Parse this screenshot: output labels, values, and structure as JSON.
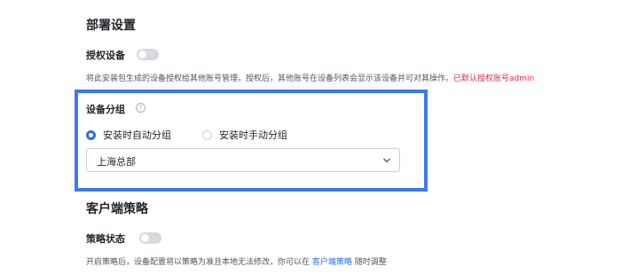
{
  "deploy": {
    "title": "部署设置",
    "auth": {
      "label": "授权设备",
      "desc_main": "将此安装包生成的设备授权给其他账号管理，授权后，其他账号在设备列表会显示该设备并可对其操作。",
      "desc_warn": "已默认授权账号admin"
    },
    "grouping": {
      "label": "设备分组",
      "help_icon_text": "?",
      "options": [
        {
          "label": "安装时自动分组",
          "selected": true
        },
        {
          "label": "安装时手动分组",
          "selected": false
        }
      ],
      "select_value": "上海总部"
    }
  },
  "client": {
    "title": "客户端策略",
    "policy": {
      "label": "策略状态",
      "desc_before": "开启策略后，设备配置将以策略为准且本地无法修改，你可以在 ",
      "desc_link": "客户端策略",
      "desc_after": " 随时调整"
    }
  },
  "colors": {
    "accent": "#2f6bea",
    "highlight_border": "#3c7ae6",
    "warning": "#e02d45",
    "toggle_off": "#d6d9de"
  }
}
